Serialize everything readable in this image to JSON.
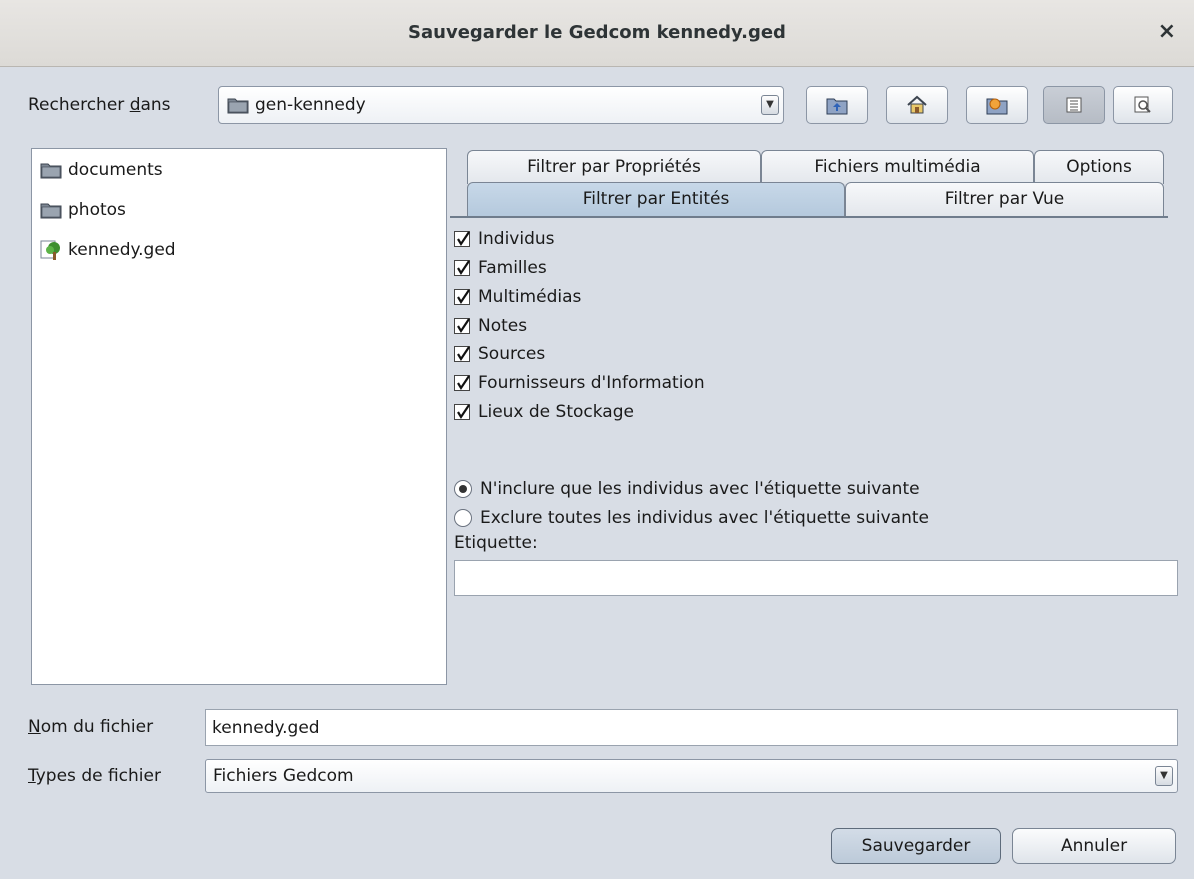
{
  "window": {
    "title": "Sauvegarder le Gedcom kennedy.ged",
    "close_glyph": "×"
  },
  "lookin": {
    "label_pre": "Rechercher ",
    "label_mn": "d",
    "label_post": "ans",
    "value": "gen-kennedy"
  },
  "toolbar_icons": [
    "up-folder-icon",
    "home-icon",
    "new-folder-icon",
    "list-view-icon",
    "details-view-icon"
  ],
  "files": [
    {
      "name": "documents",
      "type": "folder"
    },
    {
      "name": "photos",
      "type": "folder"
    },
    {
      "name": "kennedy.ged",
      "type": "gedcom"
    }
  ],
  "tabs": {
    "row1": [
      "Filtrer par Propriétés",
      "Fichiers multimédia",
      "Options"
    ],
    "row2": [
      "Filtrer par Entités",
      "Filtrer par Vue"
    ],
    "selected": "Filtrer par Entités"
  },
  "entities": [
    {
      "label": "Individus",
      "checked": true
    },
    {
      "label": "Familles",
      "checked": true
    },
    {
      "label": "Multimédias",
      "checked": true
    },
    {
      "label": "Notes",
      "checked": true
    },
    {
      "label": "Sources",
      "checked": true
    },
    {
      "label": "Fournisseurs d'Information",
      "checked": true
    },
    {
      "label": "Lieux de Stockage",
      "checked": true
    }
  ],
  "radios": [
    {
      "label": "N'inclure que les individus avec l'étiquette suivante",
      "selected": true
    },
    {
      "label": "Exclure toutes les individus avec l'étiquette suivante",
      "selected": false
    }
  ],
  "tag": {
    "label": "Etiquette:",
    "value": ""
  },
  "filename": {
    "label_mn": "N",
    "label_post": "om du fichier",
    "value": "kennedy.ged"
  },
  "filetype": {
    "label_mn": "T",
    "label_post": "ypes de fichier",
    "value": "Fichiers Gedcom"
  },
  "buttons": {
    "save": "Sauvegarder",
    "cancel": "Annuler"
  },
  "colors": {
    "background": "#d8dde5",
    "selected_tab": "#bcd0e3",
    "titlebar": "#e2e0dc"
  }
}
